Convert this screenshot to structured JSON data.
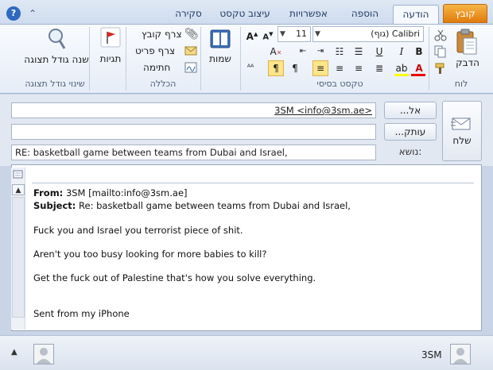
{
  "tabs": {
    "file": "קובץ",
    "message": "הודעה",
    "insert": "הוספה",
    "options": "אפשרויות",
    "format_text": "עיצוב טקסט",
    "review": "סקירה"
  },
  "ribbon": {
    "clipboard": {
      "label": "לוח",
      "paste": "הדבק"
    },
    "basic_text": {
      "label": "טקסט בסיסי",
      "font": "Calibri (גוף)",
      "size": "11"
    },
    "names": {
      "label": "שמות"
    },
    "include": {
      "label": "הכללה",
      "attach_file": "צרף קובץ",
      "attach_item": "צרף פריט",
      "signature": "חתימה"
    },
    "tags": {
      "label": "תגיות"
    },
    "zoom": {
      "label": "שינוי גודל תצוגה",
      "button": "שנה גודל תצוגה"
    }
  },
  "envelope": {
    "to_button": "...אל",
    "cc_button": "...עותק",
    "subject_label": "נושא:",
    "send_label": "שלח",
    "to_value": "3SM <info@3sm.ae>",
    "cc_value": "",
    "subject_value": "RE: basketball game between teams from Dubai and Israel,"
  },
  "body": {
    "from_label": "From:",
    "from_value": "3SM [mailto:info@3sm.ae]",
    "subject_label": "Subject:",
    "subject_value": "Re: basketball game between teams from Dubai and Israel,",
    "line1": "Fuck you and Israel you terrorist piece of shit.",
    "line2": "Aren't you too busy looking for more babies to kill?",
    "line3": "Get the fuck out of Palestine that's how you solve everything.",
    "line4": "Sent from my iPhone"
  },
  "footer": {
    "sender": "3SM"
  },
  "colors": {
    "file_tab": "#e07a0c",
    "accent": "#2f6ac0",
    "highlight": "#ffe58a"
  }
}
